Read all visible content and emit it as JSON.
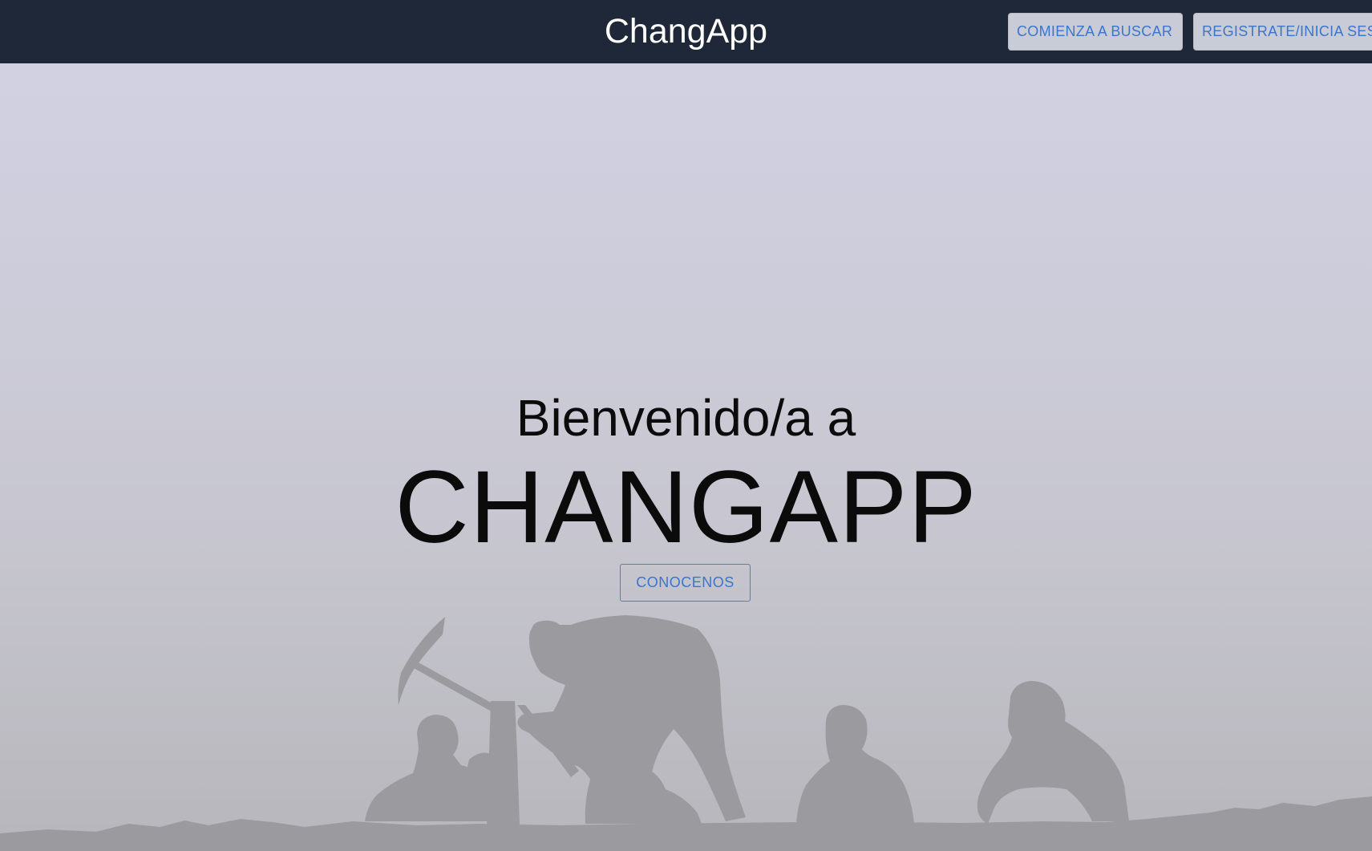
{
  "navbar": {
    "brand": "ChangApp",
    "buttons": {
      "search": "COMIENZA A BUSCAR",
      "register": "REGISTRATE/INICIA SESION"
    },
    "background_color": "#1f2839",
    "button_text_color": "#3b76cc"
  },
  "hero": {
    "welcome": "Bienvenido/a a",
    "title": "CHANGAPP",
    "cta_label": "CONOCENOS",
    "background_color": "#d2d1e2",
    "illustration": "workers-silhouette"
  }
}
